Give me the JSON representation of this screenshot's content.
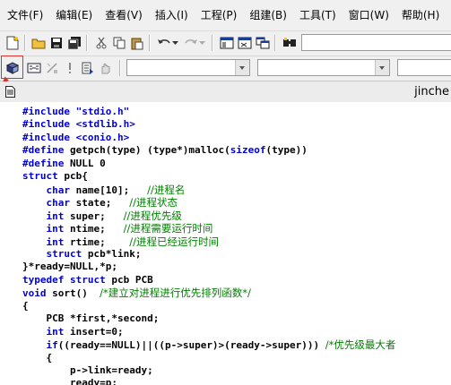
{
  "menu": {
    "items": [
      "文件(F)",
      "编辑(E)",
      "查看(V)",
      "插入(I)",
      "工程(P)",
      "组建(B)",
      "工具(T)",
      "窗口(W)",
      "帮助(H)"
    ]
  },
  "toolbar": {
    "icons": [
      "new-file-icon",
      "open-folder-icon",
      "save-icon",
      "save-all-icon",
      "cut-icon",
      "copy-icon",
      "paste-icon",
      "undo-icon",
      "redo-icon",
      "workspace-icon",
      "output-icon",
      "window-list-icon",
      "find-in-files-icon"
    ],
    "build_icons": [
      "compile-icon",
      "build-icon",
      "stop-build-icon",
      "execute-icon",
      "go-icon",
      "insert-breakpoint-icon"
    ]
  },
  "editor": {
    "title": "jinche"
  },
  "code_lines": [
    [
      [
        "#include \"stdio.h\"",
        "kw"
      ]
    ],
    [
      [
        "#include <stdlib.h>",
        "kw"
      ]
    ],
    [
      [
        "#include <conio.h>",
        "kw"
      ]
    ],
    [
      [
        "#define",
        "kw"
      ],
      [
        " getpch(type) (type*)malloc(",
        ""
      ],
      [
        "sizeof",
        "kw"
      ],
      [
        "(type))",
        ""
      ]
    ],
    [
      [
        "#define",
        "kw"
      ],
      [
        " NULL 0",
        ""
      ]
    ],
    [
      [
        "struct",
        "kw"
      ],
      [
        " pcb{",
        ""
      ]
    ],
    [
      [
        "    ",
        ""
      ],
      [
        "char",
        "kw"
      ],
      [
        " name[10];   ",
        ""
      ],
      [
        "//进程名",
        "cm"
      ]
    ],
    [
      [
        "    ",
        ""
      ],
      [
        "char",
        "kw"
      ],
      [
        " state;   ",
        ""
      ],
      [
        "//进程状态",
        "cm"
      ]
    ],
    [
      [
        "    ",
        ""
      ],
      [
        "int",
        "kw"
      ],
      [
        " super;   ",
        ""
      ],
      [
        "//进程优先级",
        "cm"
      ]
    ],
    [
      [
        "    ",
        ""
      ],
      [
        "int",
        "kw"
      ],
      [
        " ntime;   ",
        ""
      ],
      [
        "//进程需要运行时间",
        "cm"
      ]
    ],
    [
      [
        "    ",
        ""
      ],
      [
        "int",
        "kw"
      ],
      [
        " rtime;    ",
        ""
      ],
      [
        "//进程已经运行时间",
        "cm"
      ]
    ],
    [
      [
        "    ",
        ""
      ],
      [
        "struct",
        "kw"
      ],
      [
        " pcb*link;",
        ""
      ]
    ],
    [
      [
        "}*ready=NULL,*p;",
        ""
      ]
    ],
    [
      [
        "typedef",
        "kw"
      ],
      [
        " ",
        ""
      ],
      [
        "struct",
        "kw"
      ],
      [
        " pcb PCB",
        ""
      ]
    ],
    [
      [
        "void",
        "kw"
      ],
      [
        " sort()  ",
        ""
      ],
      [
        "/*建立对进程进行优先排列函数*/",
        "cm"
      ]
    ],
    [
      [
        "{",
        ""
      ]
    ],
    [
      [
        "    PCB *first,*second;",
        ""
      ]
    ],
    [
      [
        "    ",
        ""
      ],
      [
        "int",
        "kw"
      ],
      [
        " insert=0;",
        ""
      ]
    ],
    [
      [
        "    ",
        ""
      ],
      [
        "if",
        "kw"
      ],
      [
        "((ready==NULL)||((p->super)>(ready->super))) ",
        ""
      ],
      [
        "/*优先级最大者",
        "cm"
      ]
    ],
    [
      [
        "    {",
        ""
      ]
    ],
    [
      [
        "        p->link=ready;",
        ""
      ]
    ],
    [
      [
        "        ready=p;",
        ""
      ]
    ]
  ]
}
